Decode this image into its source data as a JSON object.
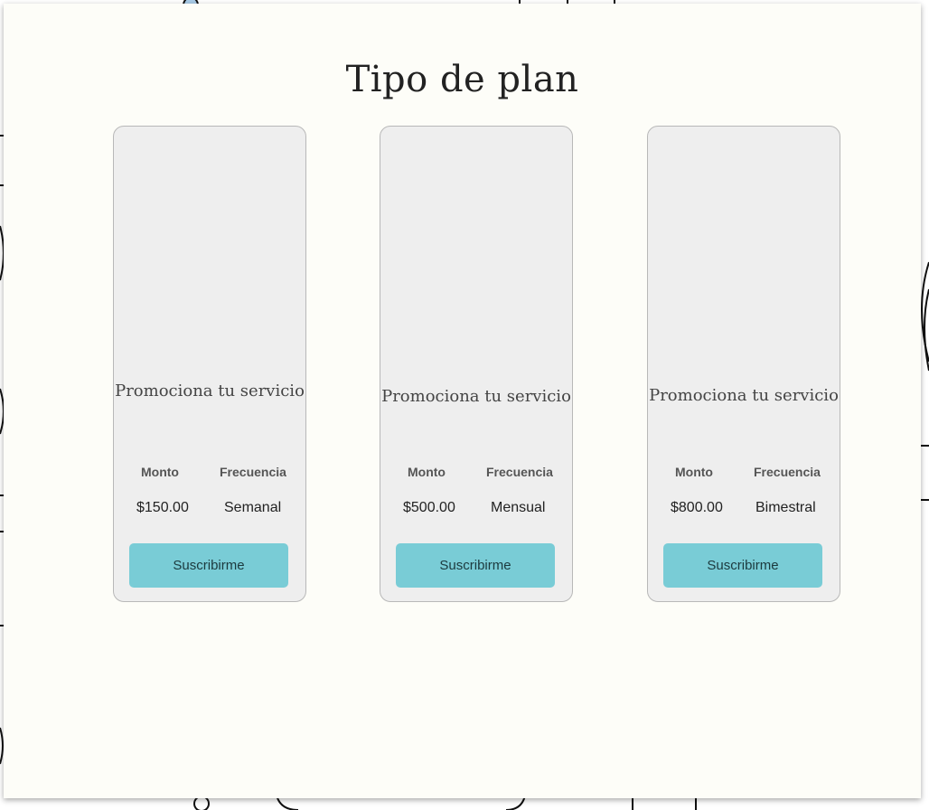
{
  "page": {
    "title": "Tipo de plan",
    "accent_color": "#79ccd6",
    "panel_color": "#fdfdf8",
    "card_color": "#eeeeee"
  },
  "columns": {
    "amount_label": "Monto",
    "frequency_label": "Frecuencia"
  },
  "plans": [
    {
      "title": "Promociona tu servicio",
      "amount": "$150.00",
      "frequency": "Semanal",
      "button_label": "Suscribirme"
    },
    {
      "title": "Promociona tu servicio",
      "amount": "$500.00",
      "frequency": "Mensual",
      "button_label": "Suscribirme"
    },
    {
      "title": "Promociona tu servicio",
      "amount": "$800.00",
      "frequency": "Bimestral",
      "button_label": "Suscribirme"
    }
  ]
}
